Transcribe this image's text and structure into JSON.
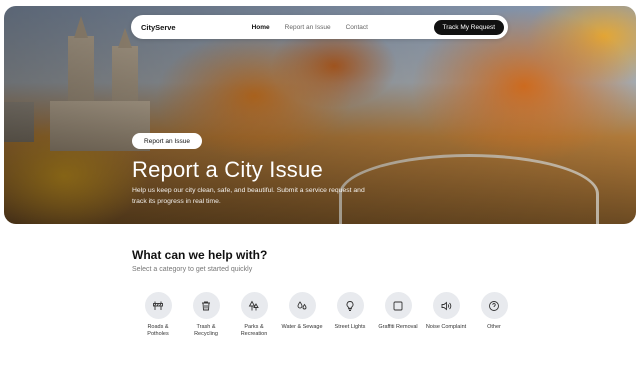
{
  "nav": {
    "brand": "CityServe",
    "links": [
      "Home",
      "Report an Issue",
      "Contact"
    ],
    "cta": "Track My Request"
  },
  "hero": {
    "pill": "Report an Issue",
    "title": "Report a City Issue",
    "subtitle": "Help us keep our city clean, safe, and beautiful. Submit a service request and track its progress in real time."
  },
  "section": {
    "title": "What can we help with?",
    "subtitle": "Select a category to get started quickly"
  },
  "categories": [
    {
      "label_line1": "Roads &",
      "label_line2": "Potholes",
      "icon": "road-barrier-icon"
    },
    {
      "label_line1": "Trash &",
      "label_line2": "Recycling",
      "icon": "trash-icon"
    },
    {
      "label_line1": "Parks &",
      "label_line2": "Recreation",
      "icon": "trees-icon"
    },
    {
      "label_line1": "Water & Sewage",
      "label_line2": "",
      "icon": "droplets-icon"
    },
    {
      "label_line1": "Street Lights",
      "label_line2": "",
      "icon": "lightbulb-icon"
    },
    {
      "label_line1": "Graffiti Removal",
      "label_line2": "",
      "icon": "square-icon"
    },
    {
      "label_line1": "Noise Complaint",
      "label_line2": "",
      "icon": "speaker-icon"
    },
    {
      "label_line1": "Other",
      "label_line2": "",
      "icon": "question-circle-icon"
    }
  ]
}
